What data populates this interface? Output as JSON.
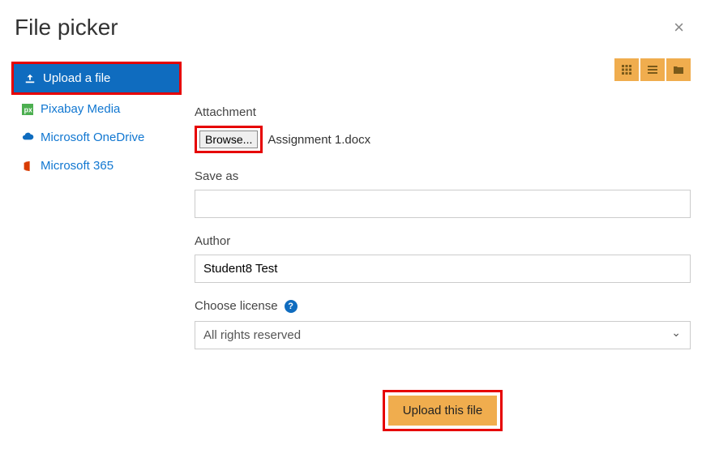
{
  "header": {
    "title": "File picker"
  },
  "sidebar": {
    "items": [
      {
        "label": "Upload a file"
      },
      {
        "label": "Pixabay Media"
      },
      {
        "label": "Microsoft OneDrive"
      },
      {
        "label": "Microsoft 365"
      }
    ]
  },
  "form": {
    "attachment_label": "Attachment",
    "browse_label": "Browse...",
    "selected_file": "Assignment 1.docx",
    "saveas_label": "Save as",
    "saveas_value": "",
    "author_label": "Author",
    "author_value": "Student8 Test",
    "license_label": "Choose license",
    "license_value": "All rights reserved",
    "submit_label": "Upload this file"
  }
}
